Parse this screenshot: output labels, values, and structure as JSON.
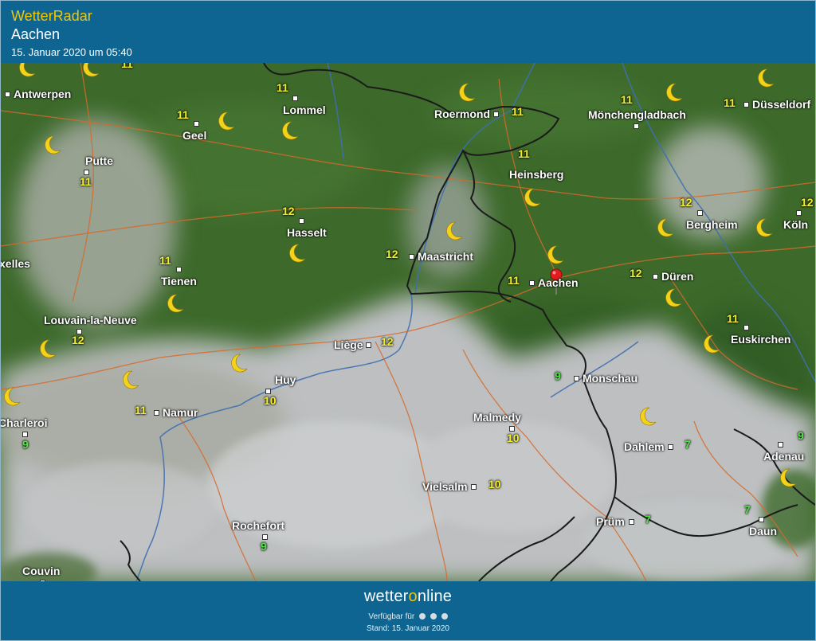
{
  "header": {
    "title": "WetterRadar",
    "location": "Aachen",
    "datetime": "15. Januar 2020 um 05:40"
  },
  "footer": {
    "logo_left": "wetter",
    "logo_o": "o",
    "logo_right": "nline",
    "available": "Verfügbar für",
    "stand": "Stand: 15. Januar 2020"
  },
  "cities": {
    "antwerpen": "Antwerpen",
    "lommel": "Lommel",
    "geel": "Geel",
    "putte": "Putte",
    "roermond": "Roermond",
    "moenchengladbach": "Mönchengladbach",
    "duesseldorf": "Düsseldorf",
    "heinsberg": "Heinsberg",
    "hasselt": "Hasselt",
    "bergheim": "Bergheim",
    "koeln": "Köln",
    "bruxelles": "xelles",
    "tienen": "Tienen",
    "maastricht": "Maastricht",
    "aachen": "Aachen",
    "dueren": "Düren",
    "louvain": "Louvain-la-Neuve",
    "liege": "Liège",
    "euskirchen": "Euskirchen",
    "huy": "Huy",
    "monschau": "Monschau",
    "namur": "Namur",
    "charleroi": "Charleroi",
    "malmedy": "Malmedy",
    "dahlem": "Dahlem",
    "adenau": "Adenau",
    "vielsalm": "Vielsalm",
    "pruem": "Prüm",
    "rochefort": "Rochefort",
    "daun": "Daun",
    "couvin": "Couvin"
  },
  "temps": {
    "top_edge": "11",
    "lommel": "11",
    "geel": "11",
    "putte": "11",
    "roermond": "11",
    "moenchengladbach": "11",
    "duesseldorf": "11",
    "heinsberg": "11",
    "hasselt": "12",
    "bergheim": "12",
    "koeln": "12",
    "tienen": "11",
    "maastricht": "12",
    "aachen": "11",
    "dueren": "12",
    "louvain": "12",
    "liege": "12",
    "euskirchen": "11",
    "huy": "10",
    "monschau": "9",
    "namur": "11",
    "charleroi": "9",
    "malmedy": "10",
    "dahlem": "7",
    "adenau": "9",
    "vielsalm": "10",
    "pruem": "7",
    "rochefort": "9",
    "daun": "7"
  },
  "colors": {
    "header_bg": "#0e6591",
    "accent": "#f3c700",
    "land": "#3f6a2c",
    "cloud": "#b9bcbf",
    "temp_warm": "#f2ee2a",
    "temp_cool": "#52e24a",
    "moon": "#f5d21a"
  },
  "icons": {
    "night": "moon-icon",
    "marker": "location-pin-icon"
  }
}
